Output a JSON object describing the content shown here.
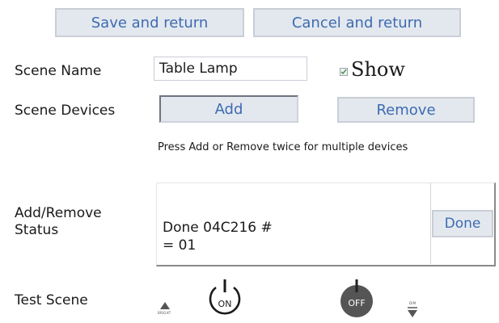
{
  "toolbar": {
    "save_label": "Save and return",
    "cancel_label": "Cancel and return"
  },
  "scene_name": {
    "label": "Scene Name",
    "value": "Table Lamp",
    "show_label": "Show",
    "show_checked": true
  },
  "scene_devices": {
    "label": "Scene Devices",
    "add_label": "Add",
    "remove_label": "Remove",
    "hint": "Press Add or Remove twice for multiple devices"
  },
  "status": {
    "label_line1": "Add/Remove",
    "label_line2": "Status",
    "text_line1": "Done 04C216 #",
    "text_line2": "= 01",
    "done_label": "Done"
  },
  "test_scene": {
    "label": "Test Scene",
    "bright_label": "BRIGHT",
    "on_label": "ON",
    "off_label": "OFF",
    "dim_label": "DIM"
  },
  "colors": {
    "button_text": "#3d6bb0",
    "button_bg": "#e3e8ef",
    "off_button": "#555555"
  }
}
